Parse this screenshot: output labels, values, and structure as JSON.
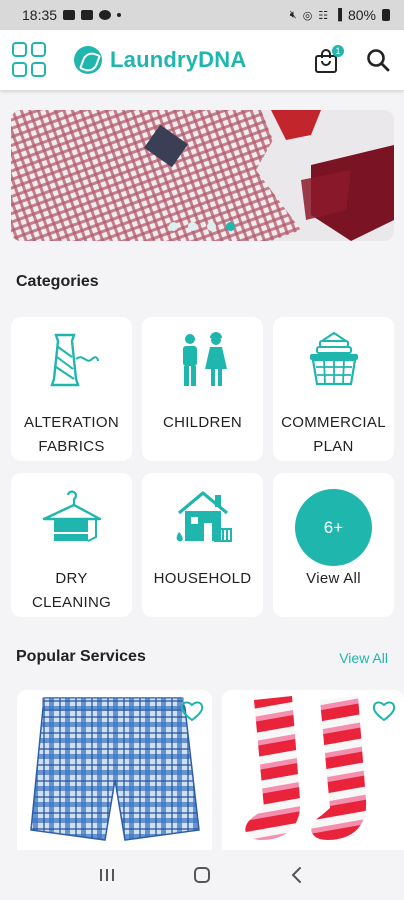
{
  "status_bar": {
    "time": "18:35",
    "battery": "80%"
  },
  "header": {
    "app_name": "LaundryDNA",
    "cart_count": "1",
    "accent_color": "#1fb6ad",
    "icons": [
      "grid-menu-icon",
      "brand-leaf-logo",
      "shopping-bag-icon",
      "search-icon"
    ]
  },
  "banner": {
    "slide_count": 4,
    "active_slide": 4
  },
  "categories": {
    "title": "Categories",
    "items": [
      {
        "label": "ALTERATION\nFABRICS",
        "icon": "thread-spool-icon"
      },
      {
        "label": "CHILDREN",
        "icon": "children-icon"
      },
      {
        "label": "COMMERCIAL\nPLAN",
        "icon": "laundry-basket-icon"
      },
      {
        "label": "DRY\nCLEANING",
        "icon": "hanger-icon"
      },
      {
        "label": "HOUSEHOLD",
        "icon": "house-icon"
      },
      {
        "label": "View All",
        "badge": "6+"
      }
    ]
  },
  "popular": {
    "title": "Popular Services",
    "view_all": "View All",
    "items": [
      {
        "image": "plaid-boxer-shorts",
        "icon": "heart-outline-icon"
      },
      {
        "image": "striped-socks",
        "icon": "heart-outline-icon"
      }
    ]
  },
  "nav": {
    "icons": [
      "recent-apps-icon",
      "home-icon",
      "back-icon"
    ]
  }
}
